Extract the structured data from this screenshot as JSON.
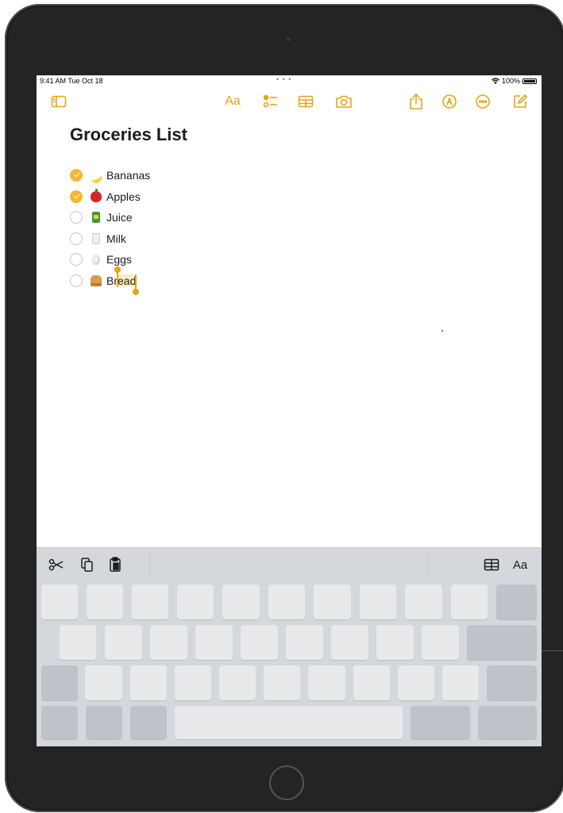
{
  "status_bar": {
    "time": "9:41 AM  Tue Oct 18",
    "dots": "• • •",
    "battery": "100%"
  },
  "toolbar": {
    "format_label": "Aa",
    "icons": [
      "sidebar-icon",
      "format-icon",
      "checklist-icon",
      "table-icon",
      "camera-icon",
      "share-icon",
      "markup-icon",
      "more-icon",
      "compose-icon"
    ],
    "accent_color": "#e8a317"
  },
  "note": {
    "title": "Groceries List",
    "items": [
      {
        "label": "Bananas",
        "checked": true,
        "icon": "banana-emoji"
      },
      {
        "label": "Apples",
        "checked": true,
        "icon": "apple-emoji"
      },
      {
        "label": "Juice",
        "checked": false,
        "icon": "juice-emoji"
      },
      {
        "label": "Milk",
        "checked": false,
        "icon": "milk-emoji"
      },
      {
        "label": "Eggs",
        "checked": false,
        "icon": "egg-emoji"
      },
      {
        "label_before": "Br",
        "label_selected": "ead",
        "checked": false,
        "icon": "bread-emoji"
      }
    ],
    "check_color": "#f5b731",
    "selection_color": "#fbeec2"
  },
  "keyboard_bar": {
    "icons": [
      "cut-icon",
      "copy-icon",
      "paste-icon",
      "table-icon"
    ],
    "format_label": "Aa"
  }
}
